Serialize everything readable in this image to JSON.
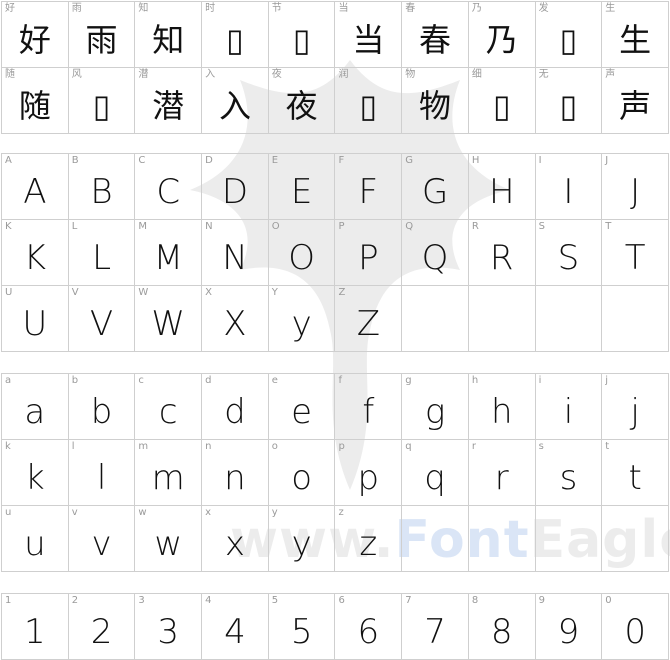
{
  "hanzi": [
    {
      "key": "好",
      "glyph": "好"
    },
    {
      "key": "雨",
      "glyph": "雨"
    },
    {
      "key": "知",
      "glyph": "知"
    },
    {
      "key": "时",
      "glyph": "▯"
    },
    {
      "key": "节",
      "glyph": "▯"
    },
    {
      "key": "当",
      "glyph": "当"
    },
    {
      "key": "春",
      "glyph": "春"
    },
    {
      "key": "乃",
      "glyph": "乃"
    },
    {
      "key": "发",
      "glyph": "▯"
    },
    {
      "key": "生",
      "glyph": "生"
    },
    {
      "key": "随",
      "glyph": "随"
    },
    {
      "key": "风",
      "glyph": "▯"
    },
    {
      "key": "潜",
      "glyph": "潜"
    },
    {
      "key": "入",
      "glyph": "入"
    },
    {
      "key": "夜",
      "glyph": "夜"
    },
    {
      "key": "润",
      "glyph": "▯"
    },
    {
      "key": "物",
      "glyph": "物"
    },
    {
      "key": "细",
      "glyph": "▯"
    },
    {
      "key": "无",
      "glyph": "▯"
    },
    {
      "key": "声",
      "glyph": "声"
    }
  ],
  "upper": [
    {
      "key": "A",
      "glyph": "A"
    },
    {
      "key": "B",
      "glyph": "B"
    },
    {
      "key": "C",
      "glyph": "C"
    },
    {
      "key": "D",
      "glyph": "D"
    },
    {
      "key": "E",
      "glyph": "E"
    },
    {
      "key": "F",
      "glyph": "F"
    },
    {
      "key": "G",
      "glyph": "G"
    },
    {
      "key": "H",
      "glyph": "H"
    },
    {
      "key": "I",
      "glyph": "I"
    },
    {
      "key": "J",
      "glyph": "J"
    },
    {
      "key": "K",
      "glyph": "K"
    },
    {
      "key": "L",
      "glyph": "L"
    },
    {
      "key": "M",
      "glyph": "M"
    },
    {
      "key": "N",
      "glyph": "N"
    },
    {
      "key": "O",
      "glyph": "O"
    },
    {
      "key": "P",
      "glyph": "P"
    },
    {
      "key": "Q",
      "glyph": "Q"
    },
    {
      "key": "R",
      "glyph": "R"
    },
    {
      "key": "S",
      "glyph": "S"
    },
    {
      "key": "T",
      "glyph": "T"
    },
    {
      "key": "U",
      "glyph": "U"
    },
    {
      "key": "V",
      "glyph": "V"
    },
    {
      "key": "W",
      "glyph": "W"
    },
    {
      "key": "X",
      "glyph": "X"
    },
    {
      "key": "Y",
      "glyph": "y"
    },
    {
      "key": "Z",
      "glyph": "Z"
    },
    {
      "key": "",
      "glyph": ""
    },
    {
      "key": "",
      "glyph": ""
    },
    {
      "key": "",
      "glyph": ""
    },
    {
      "key": "",
      "glyph": ""
    }
  ],
  "lower": [
    {
      "key": "a",
      "glyph": "a"
    },
    {
      "key": "b",
      "glyph": "b"
    },
    {
      "key": "c",
      "glyph": "c"
    },
    {
      "key": "d",
      "glyph": "d"
    },
    {
      "key": "e",
      "glyph": "e"
    },
    {
      "key": "f",
      "glyph": "f"
    },
    {
      "key": "g",
      "glyph": "g"
    },
    {
      "key": "h",
      "glyph": "h"
    },
    {
      "key": "i",
      "glyph": "i"
    },
    {
      "key": "j",
      "glyph": "j"
    },
    {
      "key": "k",
      "glyph": "k"
    },
    {
      "key": "l",
      "glyph": "l"
    },
    {
      "key": "m",
      "glyph": "m"
    },
    {
      "key": "n",
      "glyph": "n"
    },
    {
      "key": "o",
      "glyph": "o"
    },
    {
      "key": "p",
      "glyph": "p"
    },
    {
      "key": "q",
      "glyph": "q"
    },
    {
      "key": "r",
      "glyph": "r"
    },
    {
      "key": "s",
      "glyph": "s"
    },
    {
      "key": "t",
      "glyph": "t"
    },
    {
      "key": "u",
      "glyph": "u"
    },
    {
      "key": "v",
      "glyph": "v"
    },
    {
      "key": "w",
      "glyph": "w"
    },
    {
      "key": "x",
      "glyph": "x"
    },
    {
      "key": "y",
      "glyph": "y"
    },
    {
      "key": "z",
      "glyph": "z"
    },
    {
      "key": "",
      "glyph": ""
    },
    {
      "key": "",
      "glyph": ""
    },
    {
      "key": "",
      "glyph": ""
    },
    {
      "key": "",
      "glyph": ""
    }
  ],
  "digits": [
    {
      "key": "1",
      "glyph": "1"
    },
    {
      "key": "2",
      "glyph": "2"
    },
    {
      "key": "3",
      "glyph": "3"
    },
    {
      "key": "4",
      "glyph": "4"
    },
    {
      "key": "5",
      "glyph": "5"
    },
    {
      "key": "6",
      "glyph": "6"
    },
    {
      "key": "7",
      "glyph": "7"
    },
    {
      "key": "8",
      "glyph": "8"
    },
    {
      "key": "9",
      "glyph": "9"
    },
    {
      "key": "0",
      "glyph": "0"
    }
  ],
  "watermark": {
    "part1": "www.",
    "part2": "Font",
    "part3": "Eagle.com"
  },
  "colors": {
    "grid_line": "#cfcfcf",
    "key_text": "#9a9a9a",
    "glyph_text": "#111111"
  }
}
